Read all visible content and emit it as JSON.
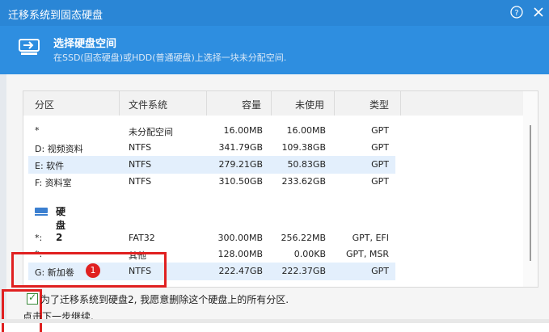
{
  "window": {
    "title": "迁移系统到固态硬盘",
    "help_icon": "?",
    "close_icon": "✕"
  },
  "header": {
    "title": "选择硬盘空间",
    "subtitle": "在SSD(固态硬盘)或HDD(普通硬盘)上选择一块未分配空间."
  },
  "table": {
    "columns": [
      "分区",
      "文件系统",
      "容量",
      "未使用",
      "类型"
    ],
    "disk1": [
      {
        "name": "*",
        "fs": "未分配空间",
        "capacity": "16.00MB",
        "unused": "16.00MB",
        "type": "GPT"
      },
      {
        "name": "D: 视频资料",
        "fs": "NTFS",
        "capacity": "341.79GB",
        "unused": "109.38GB",
        "type": "GPT"
      },
      {
        "name": "E: 软件",
        "fs": "NTFS",
        "capacity": "279.21GB",
        "unused": "50.83GB",
        "type": "GPT"
      },
      {
        "name": "F: 资料室",
        "fs": "NTFS",
        "capacity": "310.50GB",
        "unused": "233.62GB",
        "type": "GPT"
      }
    ],
    "disk2_label": "硬盘2",
    "disk2": [
      {
        "name": "*:",
        "fs": "FAT32",
        "capacity": "300.00MB",
        "unused": "256.22MB",
        "type": "GPT, EFI"
      },
      {
        "name": "*:",
        "fs": "其他",
        "capacity": "128.00MB",
        "unused": "0.00KB",
        "type": "GPT, MSR"
      },
      {
        "name": "G: 新加卷",
        "fs": "NTFS",
        "capacity": "222.47GB",
        "unused": "222.37GB",
        "type": "GPT"
      }
    ]
  },
  "annotations": {
    "badge1": "1"
  },
  "confirm_text": "为了迁移系统到硬盘2, 我愿意删除这个硬盘上的所有分区.",
  "hint_text": "点击下一步继续."
}
